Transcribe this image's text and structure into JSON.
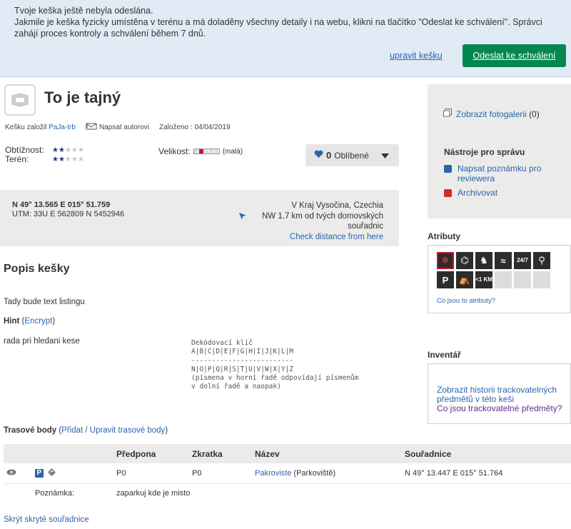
{
  "notice": {
    "line1": "Tvoje keška ještě nebyla odeslána.",
    "line2": "Jakmile je keška fyzicky umístěna v terénu a má doladěny všechny detaily i na webu, klikni na tlačítko \"Odeslat ke schválení\". Správci zahájí proces kontroly a schválení během 7 dnů.",
    "edit_label": "upravit kešku",
    "send_label": "Odeslat ke schválení"
  },
  "cache": {
    "title": "To je tajný",
    "founded_by_prefix": "Kešku založil",
    "owner": "PaJa-trb",
    "message_owner": "Napsat autorovi",
    "placed": "Založeno : 04/04/2019",
    "difficulty_label": "Obtížnost:",
    "terrain_label": "Terén:",
    "difficulty_stars": 2,
    "terrain_stars": 2,
    "size_label": "Velikost:",
    "size_text": "(malá)",
    "favorites_count": "0",
    "favorites_label": "Oblíbené"
  },
  "coords": {
    "main": "N 49° 13.565 E 015° 51.759",
    "utm": "UTM: 33U E 562809 N 5452946",
    "region": "V Kraj Vysočina, Czechia",
    "distance": "NW 1.7 km od tvých domovských souřadnic",
    "check_distance": "Check distance from here"
  },
  "description": {
    "title": "Popis kešky",
    "listing": "Tady bude text listingu",
    "hint_label": "Hint",
    "encrypt_label": "Encrypt",
    "hint_text": "rada pri hledani kese",
    "decode_key": "Dekódovací klíč\nA|B|C|D|E|F|G|H|I|J|K|L|M\n-------------------------\nN|O|P|Q|R|S|T|U|V|W|X|Y|Z\n(písmena v horní řadě odpovídají písmenům\nv dolní řadě a naopak)"
  },
  "waypoints": {
    "title": "Trasové body",
    "edit_link": "Přidat / Upravit trasové body",
    "columns": [
      "Předpona",
      "Zkratka",
      "Název",
      "Souřadnice"
    ],
    "row": {
      "prefix": "P0",
      "code": "P0",
      "name": "Pakroviste",
      "type": "(Parkoviště)",
      "coords": "N 49° 13.447 E 015° 51.764"
    },
    "note_label": "Poznámka:",
    "note_text": "zaparkuj kde je misto",
    "hide_coords": "Skrýt skryté souřadnice"
  },
  "sidebar": {
    "gallery": "Zobrazit fotogalerii",
    "gallery_count": "(0)",
    "tools_title": "Nástroje pro správu",
    "reviewer_note": "Napsat poznámku pro reviewera",
    "archive": "Archivovat",
    "attributes_title": "Atributy",
    "attributes_link": "Co jsou to atributy?",
    "attributes": [
      "snowflake-icon",
      "binoculars-icon",
      "dog-icon",
      "swim-icon",
      "24/7",
      "hiker-icon",
      "P",
      "picnic-icon",
      "<1 KM"
    ],
    "inventory_title": "Inventář",
    "inv_history": "Zobrazit historii trackovatelných předmětů v této keši",
    "inv_what": "Co jsou trackovatelné předměty?"
  },
  "colors": {
    "accent": "#02874d",
    "link": "#2b64ad",
    "banner": "#e1ebf6",
    "panel": "#ebebea"
  }
}
